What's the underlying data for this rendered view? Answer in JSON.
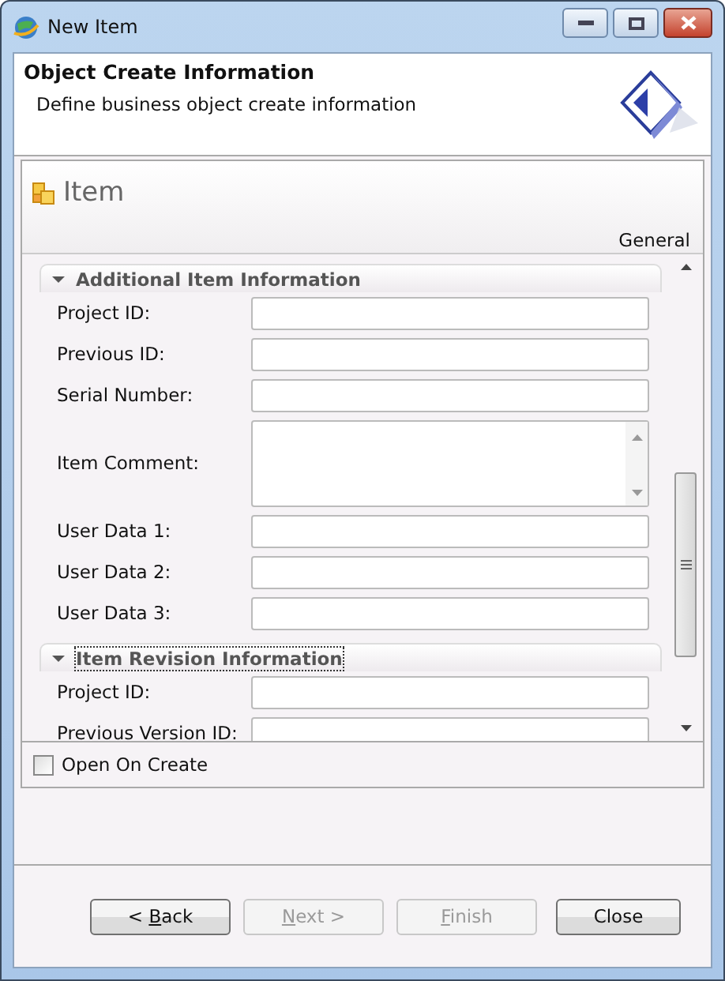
{
  "window": {
    "title": "New Item"
  },
  "header": {
    "title": "Object Create Information",
    "description": "Define business object create information"
  },
  "form": {
    "title": "Item",
    "tab": "General",
    "sections": [
      {
        "title": "Additional Item Information",
        "expanded": true,
        "focused": false,
        "fields": [
          {
            "label": "Project ID:",
            "kind": "text"
          },
          {
            "label": "Previous ID:",
            "kind": "text"
          },
          {
            "label": "Serial Number:",
            "kind": "text"
          },
          {
            "label": "Item Comment:",
            "kind": "multiline"
          },
          {
            "label": "User Data 1:",
            "kind": "text"
          },
          {
            "label": "User Data 2:",
            "kind": "text"
          },
          {
            "label": "User Data 3:",
            "kind": "text"
          }
        ]
      },
      {
        "title": "Item Revision Information",
        "expanded": true,
        "focused": true,
        "fields": [
          {
            "label": "Project ID:",
            "kind": "text"
          },
          {
            "label": "Previous Version ID:",
            "kind": "text"
          }
        ]
      }
    ]
  },
  "open_on_create": {
    "label": "Open On Create",
    "checked": false
  },
  "buttons": [
    {
      "before": "< ",
      "mnemonic": "B",
      "after": "ack",
      "disabled": false
    },
    {
      "mnemonic": "N",
      "after": "ext >",
      "disabled": true
    },
    {
      "mnemonic": "F",
      "after": "inish",
      "disabled": true
    },
    {
      "before": "Close",
      "disabled": false
    }
  ]
}
